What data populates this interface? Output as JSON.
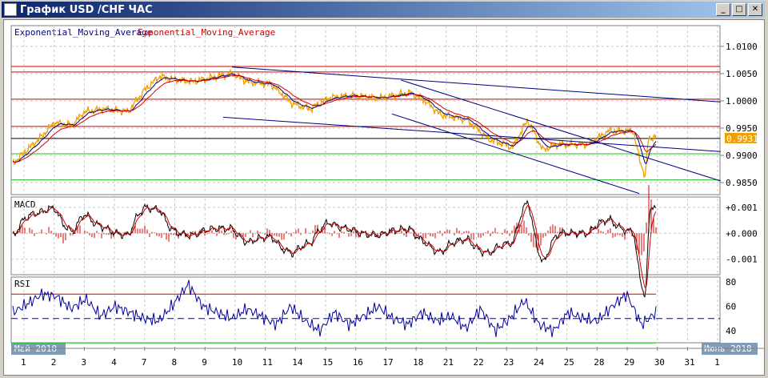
{
  "window": {
    "title": "График USD /CHF  ЧАС",
    "minimize": "_",
    "maximize": "□",
    "close": "✕"
  },
  "legend": {
    "ema1": "Exponential_Moving_Average",
    "ema2": "Exponential_Moving_Average"
  },
  "colors": {
    "price": "#f0a000",
    "ema1": "#000080",
    "ema2": "#d00000",
    "resistance": "#d00000",
    "support": "#20c020",
    "current": "#000000"
  },
  "panels": {
    "macd": "MACD",
    "rsi": "RSI"
  },
  "chart_data": {
    "type": "line",
    "title": "USD/CHF H1",
    "y_ticks": [
      "1.0100",
      "1.0050",
      "1.0000",
      "0.9950",
      "0.9900",
      "0.9850"
    ],
    "y_range": [
      0.9828,
      1.0138
    ],
    "current_price": "0.9931",
    "x_ticks": [
      "1",
      "2",
      "3",
      "4",
      "7",
      "8",
      "9",
      "10",
      "11",
      "14",
      "15",
      "16",
      "17",
      "18",
      "21",
      "22",
      "23",
      "24",
      "25",
      "28",
      "29",
      "30",
      "31",
      "1"
    ],
    "month_labels": {
      "start": "Май 2018",
      "end": "Июнь 2018"
    },
    "price": [
      [
        -0.37,
        0.9885
      ],
      [
        0,
        0.9905
      ],
      [
        0.5,
        0.993
      ],
      [
        1,
        0.996
      ],
      [
        1.6,
        0.9955
      ],
      [
        2,
        0.998
      ],
      [
        2.65,
        0.9985
      ],
      [
        3.45,
        0.998
      ],
      [
        4,
        1.002
      ],
      [
        4.5,
        1.0045
      ],
      [
        4.9,
        1.004
      ],
      [
        5.6,
        1.0035
      ],
      [
        6.4,
        1.0045
      ],
      [
        6.9,
        1.005
      ],
      [
        7.4,
        1.0035
      ],
      [
        8.2,
        1.003
      ],
      [
        8.9,
        0.9995
      ],
      [
        9.5,
        0.9985
      ],
      [
        10.1,
        1.0005
      ],
      [
        10.8,
        1.001
      ],
      [
        11.8,
        1.0005
      ],
      [
        12.8,
        1.0015
      ],
      [
        13.3,
        1.0
      ],
      [
        13.8,
        0.9975
      ],
      [
        14.7,
        0.9965
      ],
      [
        15.4,
        0.993
      ],
      [
        16.2,
        0.9915
      ],
      [
        16.7,
        0.9965
      ],
      [
        17.2,
        0.991
      ],
      [
        17.7,
        0.992
      ],
      [
        18.7,
        0.992
      ],
      [
        19.4,
        0.9945
      ],
      [
        20.2,
        0.9945
      ],
      [
        20.4,
        0.9895
      ],
      [
        20.6,
        0.986
      ],
      [
        20.7,
        0.993
      ],
      [
        20.95,
        0.9935
      ]
    ],
    "horizontal_levels": {
      "resistance": [
        1.0063,
        1.0053,
        1.0003,
        0.9953
      ],
      "support": [
        0.9903,
        0.9855
      ],
      "current": 0.9931
    },
    "trendlines": [
      [
        [
          6.9,
          1.0062
        ],
        [
          23.1,
          0.9998
        ]
      ],
      [
        [
          12.5,
          1.0038
        ],
        [
          23.1,
          0.9853
        ]
      ],
      [
        [
          12.2,
          0.9976
        ],
        [
          20.4,
          0.983
        ]
      ],
      [
        [
          6.6,
          0.997
        ],
        [
          23.1,
          0.9907
        ]
      ]
    ],
    "macd": {
      "y_ticks": [
        "+0.001",
        "+0.000",
        "-0.001"
      ],
      "range": [
        -0.0016,
        0.0014
      ]
    },
    "rsi": {
      "y_ticks": [
        "80",
        "60",
        "40"
      ],
      "levels": [
        70,
        50,
        30
      ],
      "values": [
        55,
        62,
        70,
        68,
        58,
        66,
        52,
        60,
        55,
        50,
        48,
        62,
        78,
        60,
        55,
        50,
        58,
        52,
        45,
        60,
        48,
        40,
        55,
        45,
        52,
        60,
        50,
        45,
        55,
        48,
        52,
        42,
        58,
        40,
        50,
        65,
        45,
        40,
        55,
        50,
        48,
        60,
        70,
        45,
        55
      ]
    }
  }
}
